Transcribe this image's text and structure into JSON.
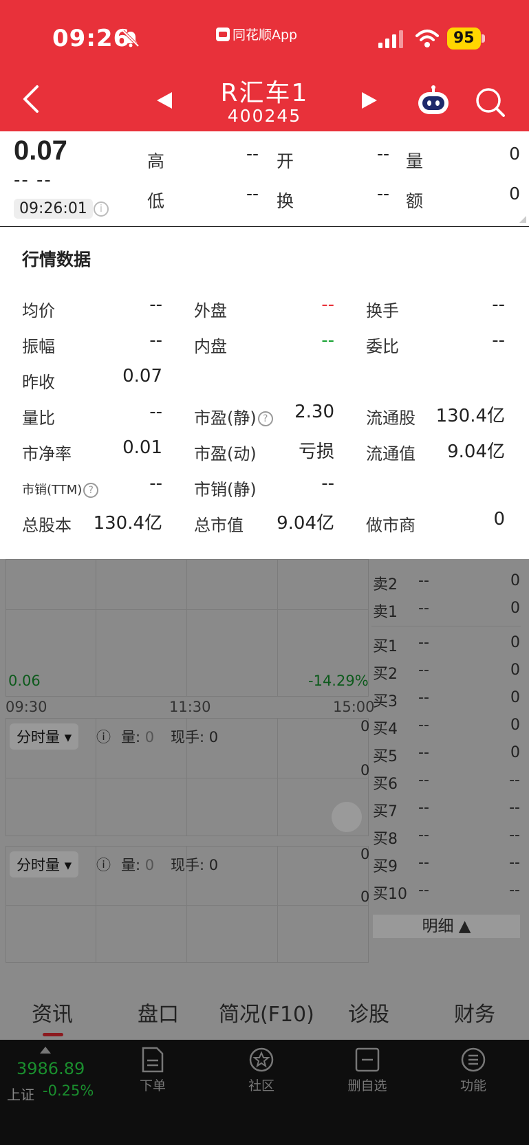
{
  "status_bar": {
    "time": "09:26",
    "app_name": "同花顺App",
    "battery": "95"
  },
  "header": {
    "stock_name": "R汇车1",
    "stock_code": "400245"
  },
  "quote": {
    "price": "0.07",
    "change": "-- --",
    "time": "09:26:01",
    "fields": [
      {
        "label": "高",
        "value": "--"
      },
      {
        "label": "开",
        "value": "--"
      },
      {
        "label": "量",
        "value": "0"
      },
      {
        "label": "低",
        "value": "--"
      },
      {
        "label": "换",
        "value": "--"
      },
      {
        "label": "额",
        "value": "0"
      }
    ]
  },
  "panel": {
    "title": "行情数据",
    "rows": [
      [
        {
          "label": "均价",
          "value": "--"
        },
        {
          "label": "外盘",
          "value": "--"
        },
        {
          "label": "换手",
          "value": "--"
        }
      ],
      [
        {
          "label": "振幅",
          "value": "--"
        },
        {
          "label": "内盘",
          "value": "--"
        },
        {
          "label": "委比",
          "value": "--"
        }
      ],
      [
        {
          "label": "昨收",
          "value": "0.07"
        }
      ],
      [
        {
          "label": "量比",
          "value": "--"
        },
        {
          "label": "市盈(静)",
          "value": "2.30"
        },
        {
          "label": "流通股",
          "value": "130.4亿"
        }
      ],
      [
        {
          "label": "市净率",
          "value": "0.01"
        },
        {
          "label": "市盈(动)",
          "value": "亏损"
        },
        {
          "label": "流通值",
          "value": "9.04亿"
        }
      ],
      [
        {
          "label": "市销(TTM)",
          "value": "--"
        },
        {
          "label": "市销(静)",
          "value": "--"
        }
      ],
      [
        {
          "label": "总股本",
          "value": "130.4亿"
        },
        {
          "label": "总市值",
          "value": "9.04亿"
        },
        {
          "label": "做市商",
          "value": "0"
        }
      ]
    ],
    "outer_color": "#e8313a",
    "inner_color": "#1aa334"
  },
  "chart_bg": {
    "low_price": "0.06",
    "low_pct": "-14.29%",
    "times": [
      "09:30",
      "11:30",
      "15:00"
    ],
    "vol_selector": "分时量",
    "vol_label": "量:",
    "vol_value": "0",
    "hand_label": "现手:",
    "hand_value": "0",
    "axis_zero": "0",
    "detail_label": "明细"
  },
  "order_book": [
    {
      "label": "卖2",
      "price": "--",
      "qty": "0"
    },
    {
      "label": "卖1",
      "price": "--",
      "qty": "0"
    },
    {
      "label": "买1",
      "price": "--",
      "qty": "0"
    },
    {
      "label": "买2",
      "price": "--",
      "qty": "0"
    },
    {
      "label": "买3",
      "price": "--",
      "qty": "0"
    },
    {
      "label": "买4",
      "price": "--",
      "qty": "0"
    },
    {
      "label": "买5",
      "price": "--",
      "qty": "0"
    },
    {
      "label": "买6",
      "price": "--",
      "qty": "--"
    },
    {
      "label": "买7",
      "price": "--",
      "qty": "--"
    },
    {
      "label": "买8",
      "price": "--",
      "qty": "--"
    },
    {
      "label": "买9",
      "price": "--",
      "qty": "--"
    },
    {
      "label": "买10",
      "price": "--",
      "qty": "--"
    }
  ],
  "tabs": [
    "资讯",
    "盘口",
    "简况(F10)",
    "诊股",
    "财务"
  ],
  "bottom": {
    "index_value": "3986.89",
    "index_name": "上证",
    "index_change": "-0.25%",
    "nav": [
      "下单",
      "社区",
      "删自选",
      "功能"
    ]
  }
}
